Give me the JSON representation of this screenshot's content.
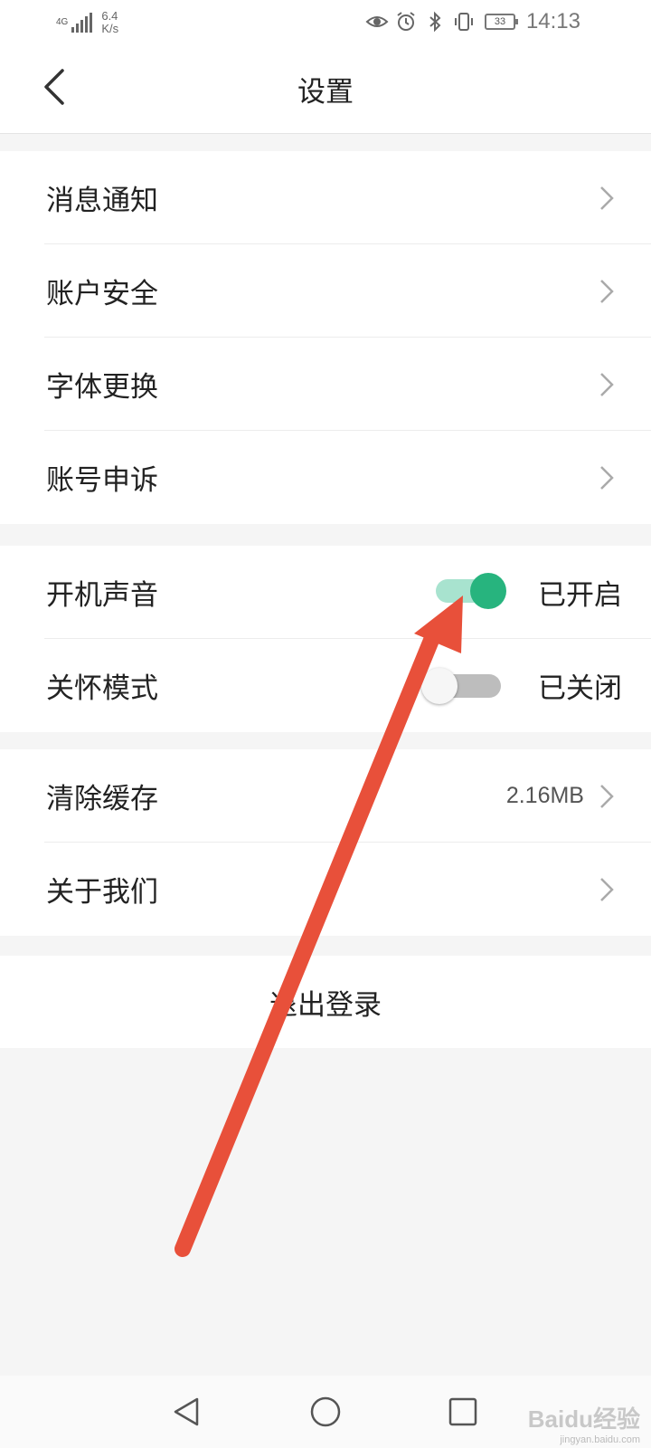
{
  "status_bar": {
    "network": "4G",
    "speed": "6.4\nK/s",
    "battery": "33",
    "time": "14:13",
    "icons": [
      "signal-icon",
      "eye-icon",
      "alarm-icon",
      "bluetooth-icon",
      "vibrate-icon",
      "battery-icon"
    ]
  },
  "header": {
    "title": "设置",
    "back_icon": "chevron-left-icon"
  },
  "groups": {
    "general": [
      {
        "label": "消息通知"
      },
      {
        "label": "账户安全"
      },
      {
        "label": "字体更换"
      },
      {
        "label": "账号申诉"
      }
    ],
    "toggles": [
      {
        "label": "开机声音",
        "state": "已开启",
        "on": true
      },
      {
        "label": "关怀模式",
        "state": "已关闭",
        "on": false
      }
    ],
    "other": [
      {
        "label": "清除缓存",
        "value": "2.16MB"
      },
      {
        "label": "关于我们"
      }
    ]
  },
  "logout": {
    "label": "退出登录"
  },
  "nav_bar": {
    "icons": [
      "back-triangle-icon",
      "home-circle-icon",
      "recents-square-icon"
    ]
  },
  "watermark": {
    "logo": "Baidu经验",
    "url": "jingyan.baidu.com"
  },
  "colors": {
    "accent": "#27b47e",
    "accent_track": "#a8e3cf",
    "annotation_arrow": "#e8503a",
    "background": "#f5f5f5"
  }
}
